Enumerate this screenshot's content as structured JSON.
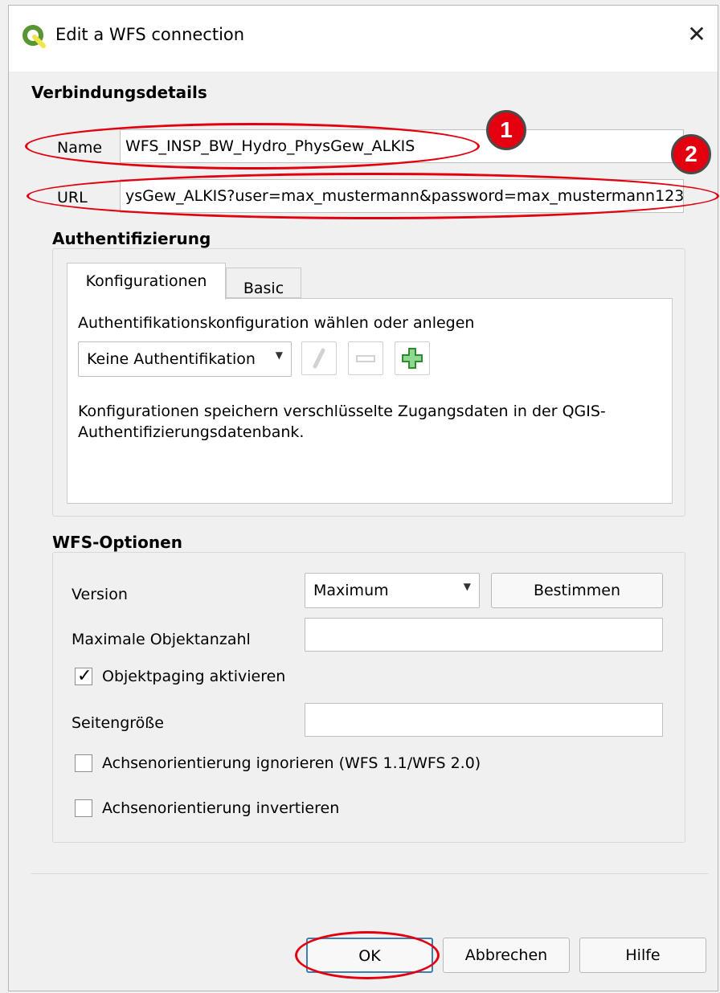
{
  "window": {
    "title": "Edit a WFS connection"
  },
  "connection": {
    "section_title": "Verbindungsdetails",
    "name_label": "Name",
    "name_value": "WFS_INSP_BW_Hydro_PhysGew_ALKIS",
    "url_label": "URL",
    "url_value": "ysGew_ALKIS?user=max_mustermann&password=max_mustermann123"
  },
  "auth": {
    "section_title": "Authentifizierung",
    "tabs": [
      "Konfigurationen",
      "Basic"
    ],
    "prompt": "Authentifikationskonfiguration wählen oder anlegen",
    "selected_config": "Keine Authentifikation",
    "info_line1": "Konfigurationen speichern verschlüsselte Zugangsdaten in der QGIS-",
    "info_line2": "Authentifizierungsdatenbank."
  },
  "wfs": {
    "section_title": "WFS-Optionen",
    "version_label": "Version",
    "version_value": "Maximum",
    "detect_button": "Bestimmen",
    "max_features_label": "Maximale Objektanzahl",
    "max_features_value": "",
    "paging_label": "Objektpaging aktivieren",
    "paging_checked": true,
    "page_size_label": "Seitengröße",
    "page_size_value": "",
    "ignore_axis_label": "Achsenorientierung ignorieren (WFS 1.1/WFS 2.0)",
    "ignore_axis_checked": false,
    "invert_axis_label": "Achsenorientierung invertieren",
    "invert_axis_checked": false
  },
  "buttons": {
    "ok": "OK",
    "cancel": "Abbrechen",
    "help": "Hilfe"
  },
  "annotations": {
    "badge1": "1",
    "badge2": "2",
    "color": "#e3000f"
  },
  "colors": {
    "qgis_green": "#589632",
    "qgis_yellow": "#f0e64a",
    "annotation_red": "#e3000f"
  }
}
